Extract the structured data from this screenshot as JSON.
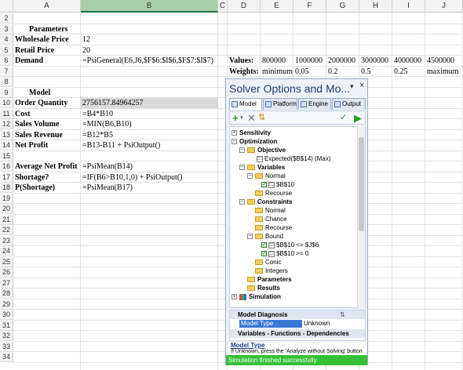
{
  "spreadsheet": {
    "columns": [
      "A",
      "B",
      "C",
      "D",
      "E",
      "F",
      "G",
      "H",
      "I",
      "J"
    ],
    "selected_column": "B",
    "rows": [
      "2",
      "3",
      "4",
      "5",
      "6",
      "7",
      "8",
      "9",
      "10",
      "11",
      "12",
      "13",
      "14",
      "15",
      "16",
      "17",
      "18",
      "19",
      "20",
      "21",
      "22",
      "23",
      "24",
      "25",
      "26",
      "27",
      "28",
      "29",
      "30",
      "31",
      "32",
      "33",
      "34"
    ],
    "cells": {
      "A3": "Parameters",
      "A4": "Wholesale Price",
      "B4": "12",
      "A5": "Retail Price",
      "B5": "20",
      "A6": "Demand",
      "B6": "=PsiGeneral(E6,J6,$F$6:$I$6,$F$7:$I$7)",
      "D6": "Values:",
      "E6": "800000",
      "F6": "1000000",
      "G6": "2000000",
      "H6": "3000000",
      "I6": "4000000",
      "J6": "4500000",
      "D7": "Weights:",
      "E7": "minimum",
      "F7": "0.05",
      "G7": "0.2",
      "H7": "0.5",
      "I7": "0.25",
      "J7": "maximum",
      "A9": "Model",
      "A10": "Order Quantity",
      "B10": "2756157.84964257",
      "A11": "Cost",
      "B11": "=B4*B10",
      "A12": "Sales Volume",
      "B12": "=MIN(B6,B10)",
      "A13": "Sales Revenue",
      "B13": "=B12*B5",
      "A14": "Net Profit",
      "B14": "=B13-B11 + PsiOutput()",
      "A16": "Average Net Profit",
      "B16": "=PsiMean(B14)",
      "A17": "Shortage?",
      "B17": "=IF(B6>B10,1,0) + PsiOutput()",
      "A18": "P(Shortage)",
      "B18": "=PsiMean(B17)"
    }
  },
  "solver": {
    "title": "Solver Options and Mo...",
    "pin_icon": "▾",
    "close_icon": "×",
    "tabs": [
      "Model",
      "Platform",
      "Engine",
      "Output"
    ],
    "tree": {
      "sensitivity": "Sensitivity",
      "optimization": "Optimization",
      "objective": "Objective",
      "objective_item": "Expected($B$14) (Max)",
      "variables": "Variables",
      "normal": "Normal",
      "var_item": "$B$10",
      "recourse": "Recourse",
      "constraints": "Constraints",
      "c_normal": "Normal",
      "chance": "Chance",
      "c_recourse": "Recourse",
      "bound": "Bound",
      "bound1": "$B$10 <= $J$6",
      "bound2": "$B$10 >= 0",
      "conic": "Conic",
      "integers": "Integers",
      "parameters": "Parameters",
      "results": "Results",
      "simulation": "Simulation"
    },
    "props": {
      "section1": "Model Diagnosis",
      "model_type_label": "Model Type",
      "model_type_value": "Unknown",
      "section2": "Variables - Functions - Dependencies"
    },
    "help_title": "Model Type",
    "help_text": "If Unknown, press the 'Analyze without Solving' button",
    "status": "Simulation finished successfully."
  }
}
